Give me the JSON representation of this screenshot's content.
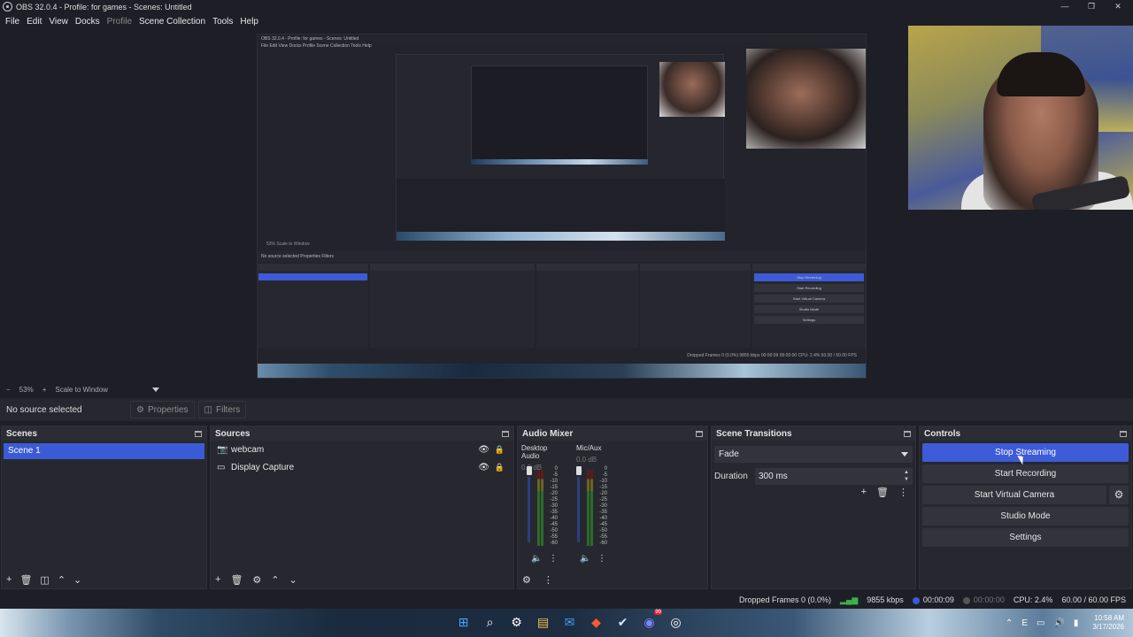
{
  "window": {
    "title": "OBS 32.0.4 - Profile: for games - Scenes: Untitled",
    "controls": [
      "—",
      "❐",
      "✕"
    ]
  },
  "menu": [
    "File",
    "Edit",
    "View",
    "Docks",
    "Profile",
    "Scene Collection",
    "Tools",
    "Help"
  ],
  "preview": {
    "nested_title": "OBS 32.0.4 - Profile: for games - Scenes: Untitled",
    "nested_menu": "File  Edit  View  Docks  Profile  Scene Collection  Tools  Help",
    "nested_zoom": "53%   Scale to Window",
    "nested_source_bar": "No source selected      Properties      Filters",
    "nested_status": "Dropped Frames 0 (0.0%)   9855 kbps   00:00:09   00:00:00   CPU: 2.4%   60.00 / 60.00 FPS",
    "nested_scenes": "Scenes",
    "nested_sources": "Sources",
    "nested_mixer": "Audio Mixer",
    "nested_transitions": "Scene Transitions",
    "nested_controls": "Controls",
    "nested_buttons": [
      "Stop Streaming",
      "Start Recording",
      "Start Virtual Camera",
      "Studio Mode",
      "Settings"
    ]
  },
  "zoom": {
    "minus": "−",
    "level": "53%",
    "plus": "+",
    "scale_mode": "Scale to Window"
  },
  "source_toolbar": {
    "no_source": "No source selected",
    "properties": "Properties",
    "filters": "Filters"
  },
  "scenes": {
    "title": "Scenes",
    "items": [
      "Scene 1"
    ]
  },
  "sources": {
    "title": "Sources",
    "items": [
      {
        "name": "webcam",
        "icon": "camera-icon"
      },
      {
        "name": "Display Capture",
        "icon": "monitor-icon"
      }
    ]
  },
  "mixer": {
    "title": "Audio Mixer",
    "channels": [
      {
        "name": "Desktop Audio",
        "db": "0.0 dB"
      },
      {
        "name": "Mic/Aux",
        "db": "0.0 dB"
      }
    ],
    "scale": [
      "0",
      "-5",
      "-10",
      "-15",
      "-20",
      "-25",
      "-30",
      "-35",
      "-40",
      "-45",
      "-50",
      "-55",
      "-60"
    ]
  },
  "transitions": {
    "title": "Scene Transitions",
    "selected": "Fade",
    "duration_label": "Duration",
    "duration_value": "300 ms"
  },
  "controls": {
    "title": "Controls",
    "stop_streaming": "Stop Streaming",
    "start_recording": "Start Recording",
    "start_virtual_camera": "Start Virtual Camera",
    "studio_mode": "Studio Mode",
    "settings": "Settings"
  },
  "status": {
    "dropped_frames": "Dropped Frames 0 (0.0%)",
    "bitrate": "9855 kbps",
    "stream_time": "00:00:09",
    "record_time": "00:00:00",
    "cpu": "CPU: 2.4%",
    "fps": "60.00 / 60.00 FPS"
  },
  "taskbar": {
    "time": "10:58 AM",
    "date": "3/17/2026",
    "badge": "99"
  },
  "colors": {
    "accent": "#3d5bd7",
    "background": "#1e1f26",
    "dock": "#27282f"
  }
}
